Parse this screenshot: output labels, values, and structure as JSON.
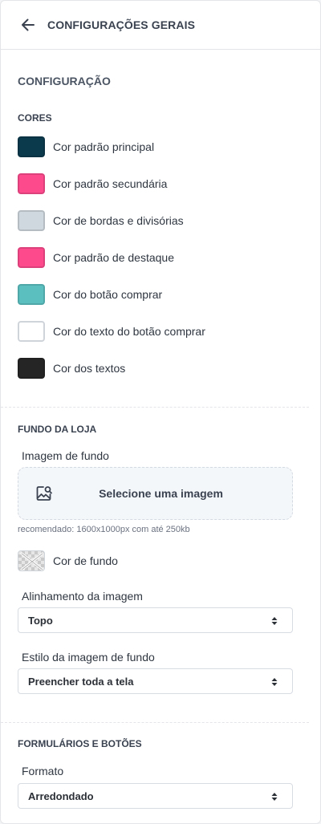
{
  "header": {
    "title": "CONFIGURAÇÕES GERAIS"
  },
  "section": {
    "title": "CONFIGURAÇÃO"
  },
  "colors": {
    "label": "CORES",
    "items": [
      {
        "label": "Cor padrão principal",
        "color": "#0c3a4d"
      },
      {
        "label": "Cor padrão secundária",
        "color": "#fc4a8d"
      },
      {
        "label": "Cor de bordas e divisórias",
        "color": "#cfd8df"
      },
      {
        "label": "Cor padrão de destaque",
        "color": "#fc4a8d"
      },
      {
        "label": "Cor do botão comprar",
        "color": "#5bbfc0"
      },
      {
        "label": "Cor do texto do botão comprar",
        "color": "#ffffff"
      },
      {
        "label": "Cor dos textos",
        "color": "#252525"
      }
    ]
  },
  "store_background": {
    "label": "FUNDO DA LOJA",
    "image_label": "Imagem de fundo",
    "upload_text": "Selecione uma imagem",
    "hint": "recomendado: 1600x1000px com até 250kb",
    "bg_color_label": "Cor de fundo",
    "alignment_label": "Alinhamento da imagem",
    "alignment_value": "Topo",
    "style_label": "Estilo da imagem de fundo",
    "style_value": "Preencher toda a tela"
  },
  "forms": {
    "label": "FORMULÁRIOS E BOTÕES",
    "format_label": "Formato",
    "format_value": "Arredondado"
  }
}
